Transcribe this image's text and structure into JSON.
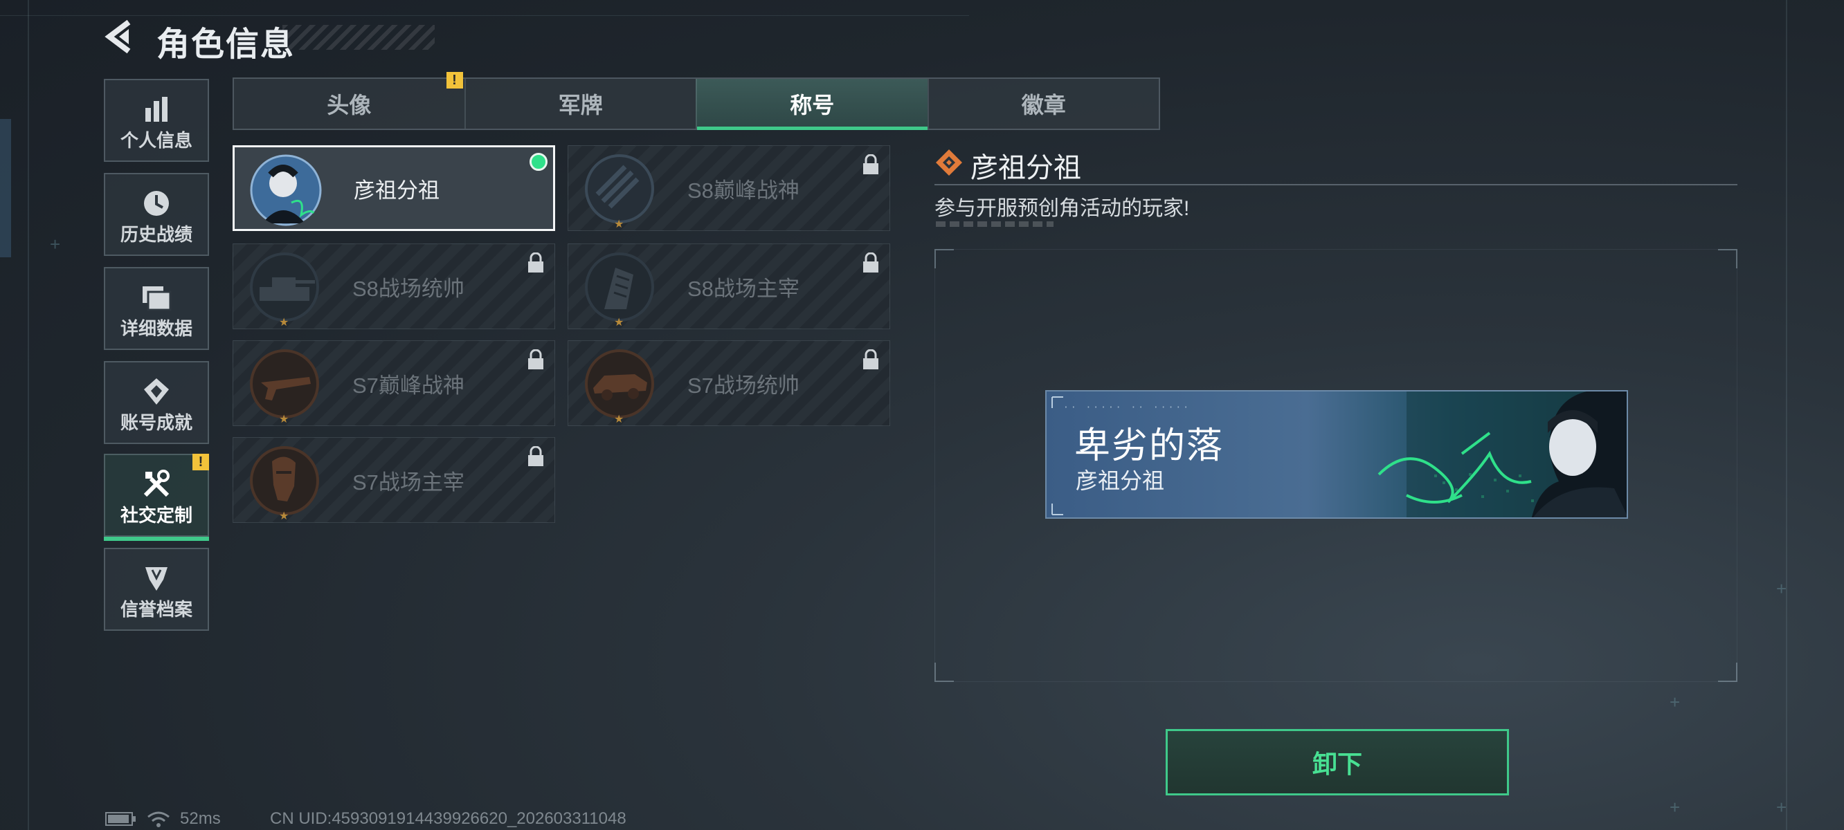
{
  "header": {
    "title": "角色信息"
  },
  "sidebar": {
    "items": [
      {
        "label": "个人信息",
        "icon": "bar-chart-icon",
        "active": false
      },
      {
        "label": "历史战绩",
        "icon": "clock-icon",
        "active": false
      },
      {
        "label": "详细数据",
        "icon": "folder-icon",
        "active": false
      },
      {
        "label": "账号成就",
        "icon": "achievement-icon",
        "active": false
      },
      {
        "label": "社交定制",
        "icon": "tools-icon",
        "active": true,
        "badge": "!"
      },
      {
        "label": "信誉档案",
        "icon": "reputation-icon",
        "active": false
      }
    ]
  },
  "tabs": [
    {
      "label": "头像",
      "badge": "!"
    },
    {
      "label": "军牌"
    },
    {
      "label": "称号",
      "active": true
    },
    {
      "label": "徽章"
    }
  ],
  "cards": [
    {
      "name": "彦祖分祖",
      "selected": true,
      "locked": false,
      "equipped": true
    },
    {
      "name": "S8巅峰战神",
      "locked": true
    },
    {
      "name": "S8战场统帅",
      "locked": true
    },
    {
      "name": "S8战场主宰",
      "locked": true
    },
    {
      "name": "S7巅峰战神",
      "locked": true
    },
    {
      "name": "S7战场统帅",
      "locked": true
    },
    {
      "name": "S7战场主宰",
      "locked": true
    }
  ],
  "detail": {
    "title": "彦祖分祖",
    "description": "参与开服预创角活动的玩家!",
    "banner": {
      "title": "卑劣的落",
      "subtitle": "彦祖分祖"
    }
  },
  "actions": {
    "unequip_label": "卸下"
  },
  "status": {
    "ping": "52ms",
    "uid": "CN UID:4593091914439926620_202603311048"
  },
  "colors": {
    "accent": "#3fc98a",
    "warning": "#f2c23a",
    "selected_border": "#f4f6f7"
  }
}
